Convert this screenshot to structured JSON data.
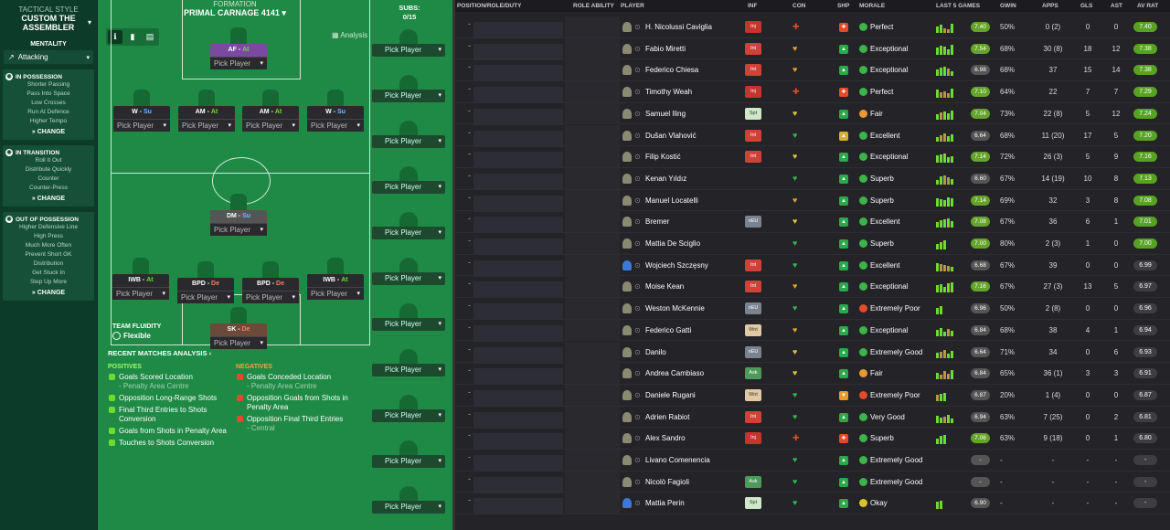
{
  "tactic": {
    "style_label": "TACTICAL STYLE",
    "style_value": "CUSTOM THE ASSEMBLER",
    "mentality_label": "MENTALITY",
    "mentality_value": "Attacking",
    "sections": [
      {
        "title": "IN POSSESSION",
        "items": [
          "Shorter Passing",
          "Pass Into Space",
          "Low Crosses",
          "Run At Defence",
          "Higher Tempo"
        ],
        "change": "CHANGE"
      },
      {
        "title": "IN TRANSITION",
        "items": [
          "Roll It Out",
          "Distribute Quickly",
          "Counter",
          "Counter-Press"
        ],
        "change": "CHANGE"
      },
      {
        "title": "OUT OF POSSESSION",
        "items": [
          "Higher Defensive Line",
          "High Press",
          "Much More Often",
          "Prevent Short GK",
          "Distribution",
          "Get Stuck In",
          "Step Up More"
        ],
        "change": "CHANGE"
      }
    ]
  },
  "formation": {
    "label": "FORMATION",
    "name": "PRIMAL CARNAGE 4141",
    "analysis": "Analysis",
    "pick": "Pick Player",
    "players": [
      {
        "pos": "AF",
        "duty": "At",
        "cls": "at"
      },
      {
        "pos": "W",
        "duty": "Su",
        "cls": "su"
      },
      {
        "pos": "AM",
        "duty": "At",
        "cls": "at"
      },
      {
        "pos": "AM",
        "duty": "At",
        "cls": "at"
      },
      {
        "pos": "W",
        "duty": "Su",
        "cls": "su"
      },
      {
        "pos": "DM",
        "duty": "Su",
        "cls": "su"
      },
      {
        "pos": "IWB",
        "duty": "At",
        "cls": "at"
      },
      {
        "pos": "BPD",
        "duty": "De",
        "cls": "de"
      },
      {
        "pos": "BPD",
        "duty": "De",
        "cls": "de"
      },
      {
        "pos": "IWB",
        "duty": "At",
        "cls": "at"
      },
      {
        "pos": "SK",
        "duty": "De",
        "cls": "de"
      }
    ],
    "fluidity_label": "TEAM FLUIDITY",
    "fluidity_value": "Flexible"
  },
  "subs": {
    "label": "SUBS:",
    "count": "0/15",
    "pick": "Pick Player"
  },
  "analysis": {
    "title": "RECENT MATCHES ANALYSIS ›",
    "pos_title": "POSITIVES",
    "neg_title": "NEGATIVES",
    "positives": [
      {
        "t": "Goals Scored Location",
        "s": "- Penalty Area Centre"
      },
      {
        "t": "Opposition Long-Range Shots",
        "s": ""
      },
      {
        "t": "Final Third Entries to Shots Conversion",
        "s": ""
      },
      {
        "t": "Goals from Shots in Penalty Area",
        "s": ""
      },
      {
        "t": "Touches to Shots Conversion",
        "s": ""
      }
    ],
    "negatives": [
      {
        "t": "Goals Conceded Location",
        "s": "- Penalty Area Centre"
      },
      {
        "t": "Opposition Goals from Shots in Penalty Area",
        "s": ""
      },
      {
        "t": "Opposition Final Third Entries",
        "s": "- Central"
      }
    ]
  },
  "table": {
    "headers": {
      "pos": "POSITION/ROLE/DUTY",
      "role": "ROLE ABILITY",
      "player": "PLAYER",
      "inf": "INF",
      "con": "CON",
      "shp": "SHP",
      "morale": "MORALE",
      "last5": "LAST 5 GAMES",
      "gwin": "GWIN",
      "apps": "APPS",
      "gls": "GLS",
      "ast": "AST",
      "avrat": "AV RAT"
    },
    "rows": [
      {
        "name": "H. Nicolussi Caviglia",
        "inf": "Inj",
        "ic": "inj",
        "con": "✚",
        "cc": "#e34a2a",
        "shp": "✚",
        "sc": "#e34a2a",
        "morale": "Perfect",
        "mc": "#3db34a",
        "lr": "7.40",
        "lg": true,
        "gw": "50%",
        "ap": "0 (2)",
        "gl": "0",
        "as": "0",
        "ar": "7.40",
        "ag": true,
        "gk": false
      },
      {
        "name": "Fabio Miretti",
        "inf": "Int",
        "ic": "int",
        "con": "♥",
        "cc": "#e0a030",
        "shp": "▲",
        "sc": "#2aa84a",
        "morale": "Exceptional",
        "mc": "#3db34a",
        "lr": "7.54",
        "lg": true,
        "gw": "68%",
        "ap": "30 (8)",
        "gl": "18",
        "as": "12",
        "ar": "7.38",
        "ag": true,
        "gk": false
      },
      {
        "name": "Federico Chiesa",
        "inf": "Int",
        "ic": "int",
        "con": "♥",
        "cc": "#e0a030",
        "shp": "▲",
        "sc": "#2aa84a",
        "morale": "Exceptional",
        "mc": "#3db34a",
        "lr": "6.98",
        "lg": false,
        "gw": "68%",
        "ap": "37",
        "gl": "15",
        "as": "14",
        "ar": "7.38",
        "ag": true,
        "gk": false
      },
      {
        "name": "Timothy Weah",
        "inf": "Inj",
        "ic": "inj",
        "con": "✚",
        "cc": "#e34a2a",
        "shp": "✚",
        "sc": "#e34a2a",
        "morale": "Perfect",
        "mc": "#3db34a",
        "lr": "7.10",
        "lg": true,
        "gw": "64%",
        "ap": "22",
        "gl": "7",
        "as": "7",
        "ar": "7.29",
        "ag": true,
        "gk": false
      },
      {
        "name": "Samuel Iling",
        "inf": "Spt",
        "ic": "spt",
        "con": "♥",
        "cc": "#d8c430",
        "shp": "▲",
        "sc": "#2aa84a",
        "morale": "Fair",
        "mc": "#e89a30",
        "lr": "7.04",
        "lg": true,
        "gw": "73%",
        "ap": "22 (8)",
        "gl": "5",
        "as": "12",
        "ar": "7.24",
        "ag": true,
        "gk": false
      },
      {
        "name": "Dušan Vlahović",
        "inf": "Int",
        "ic": "int",
        "con": "♥",
        "cc": "#2ab84a",
        "shp": "▲",
        "sc": "#d8b030",
        "morale": "Excellent",
        "mc": "#3db34a",
        "lr": "6.64",
        "lg": false,
        "gw": "68%",
        "ap": "11 (20)",
        "gl": "17",
        "as": "5",
        "ar": "7.20",
        "ag": true,
        "gk": false
      },
      {
        "name": "Filip Kostić",
        "inf": "Int",
        "ic": "int",
        "con": "♥",
        "cc": "#d8c430",
        "shp": "▲",
        "sc": "#2aa84a",
        "morale": "Exceptional",
        "mc": "#3db34a",
        "lr": "7.14",
        "lg": true,
        "gw": "72%",
        "ap": "26 (3)",
        "gl": "5",
        "as": "9",
        "ar": "7.16",
        "ag": true,
        "gk": false
      },
      {
        "name": "Kenan Yıldız",
        "inf": "",
        "ic": "none",
        "con": "♥",
        "cc": "#2ab84a",
        "shp": "▲",
        "sc": "#2aa84a",
        "morale": "Superb",
        "mc": "#3db34a",
        "lr": "6.60",
        "lg": false,
        "gw": "67%",
        "ap": "14 (19)",
        "gl": "10",
        "as": "8",
        "ar": "7.13",
        "ag": true,
        "gk": false
      },
      {
        "name": "Manuel Locatelli",
        "inf": "",
        "ic": "none",
        "con": "♥",
        "cc": "#e0a030",
        "shp": "▲",
        "sc": "#2aa84a",
        "morale": "Superb",
        "mc": "#3db34a",
        "lr": "7.14",
        "lg": true,
        "gw": "69%",
        "ap": "32",
        "gl": "3",
        "as": "8",
        "ar": "7.08",
        "ag": true,
        "gk": false
      },
      {
        "name": "Bremer",
        "inf": "nEU",
        "ic": "neu",
        "con": "♥",
        "cc": "#d8c430",
        "shp": "▲",
        "sc": "#2aa84a",
        "morale": "Excellent",
        "mc": "#3db34a",
        "lr": "7.08",
        "lg": true,
        "gw": "67%",
        "ap": "36",
        "gl": "6",
        "as": "1",
        "ar": "7.01",
        "ag": true,
        "gk": false
      },
      {
        "name": "Mattia De Sciglio",
        "inf": "",
        "ic": "none",
        "con": "♥",
        "cc": "#2ab84a",
        "shp": "▲",
        "sc": "#2aa84a",
        "morale": "Superb",
        "mc": "#3db34a",
        "lr": "7.00",
        "lg": true,
        "gw": "80%",
        "ap": "2 (3)",
        "gl": "1",
        "as": "0",
        "ar": "7.00",
        "ag": true,
        "gk": false
      },
      {
        "name": "Wojciech Szczęsny",
        "inf": "Int",
        "ic": "int",
        "con": "♥",
        "cc": "#2ab84a",
        "shp": "▲",
        "sc": "#2aa84a",
        "morale": "Excellent",
        "mc": "#3db34a",
        "lr": "6.68",
        "lg": false,
        "gw": "67%",
        "ap": "39",
        "gl": "0",
        "as": "0",
        "ar": "6.99",
        "ag": false,
        "gk": true
      },
      {
        "name": "Moise Kean",
        "inf": "Int",
        "ic": "int",
        "con": "♥",
        "cc": "#e0a030",
        "shp": "▲",
        "sc": "#2aa84a",
        "morale": "Exceptional",
        "mc": "#3db34a",
        "lr": "7.16",
        "lg": true,
        "gw": "67%",
        "ap": "27 (3)",
        "gl": "13",
        "as": "5",
        "ar": "6.97",
        "ag": false,
        "gk": false
      },
      {
        "name": "Weston McKennie",
        "inf": "nEU",
        "ic": "neu",
        "con": "♥",
        "cc": "#2ab84a",
        "shp": "▲",
        "sc": "#2aa84a",
        "morale": "Extremely Poor",
        "mc": "#e34a2a",
        "lr": "6.96",
        "lg": false,
        "gw": "50%",
        "ap": "2 (8)",
        "gl": "0",
        "as": "0",
        "ar": "6.96",
        "ag": false,
        "gk": false
      },
      {
        "name": "Federico Gatti",
        "inf": "Wnt",
        "ic": "wnt",
        "con": "♥",
        "cc": "#e0a030",
        "shp": "▲",
        "sc": "#2aa84a",
        "morale": "Exceptional",
        "mc": "#3db34a",
        "lr": "6.84",
        "lg": false,
        "gw": "68%",
        "ap": "38",
        "gl": "4",
        "as": "1",
        "ar": "6.94",
        "ag": false,
        "gk": false
      },
      {
        "name": "Danilo",
        "inf": "nEU",
        "ic": "neu",
        "con": "♥",
        "cc": "#d8c430",
        "shp": "▲",
        "sc": "#2aa84a",
        "morale": "Extremely Good",
        "mc": "#3db34a",
        "lr": "6.64",
        "lg": false,
        "gw": "71%",
        "ap": "34",
        "gl": "0",
        "as": "6",
        "ar": "6.93",
        "ag": false,
        "gk": false
      },
      {
        "name": "Andrea Cambiaso",
        "inf": "Ask",
        "ic": "ask",
        "con": "♥",
        "cc": "#d8c430",
        "shp": "▲",
        "sc": "#2aa84a",
        "morale": "Fair",
        "mc": "#e89a30",
        "lr": "6.84",
        "lg": false,
        "gw": "65%",
        "ap": "36 (1)",
        "gl": "3",
        "as": "3",
        "ar": "6.91",
        "ag": false,
        "gk": false
      },
      {
        "name": "Daniele Rugani",
        "inf": "Wnt",
        "ic": "wnt",
        "con": "♥",
        "cc": "#2ab84a",
        "shp": "▼",
        "sc": "#e89a30",
        "morale": "Extremely Poor",
        "mc": "#e34a2a",
        "lr": "6.87",
        "lg": false,
        "gw": "20%",
        "ap": "1 (4)",
        "gl": "0",
        "as": "0",
        "ar": "6.87",
        "ag": false,
        "gk": false
      },
      {
        "name": "Adrien Rabiot",
        "inf": "Int",
        "ic": "int",
        "con": "♥",
        "cc": "#2ab84a",
        "shp": "▲",
        "sc": "#2aa84a",
        "morale": "Very Good",
        "mc": "#3db34a",
        "lr": "6.94",
        "lg": false,
        "gw": "63%",
        "ap": "7 (25)",
        "gl": "0",
        "as": "2",
        "ar": "6.81",
        "ag": false,
        "gk": false
      },
      {
        "name": "Alex Sandro",
        "inf": "Inj",
        "ic": "inj",
        "con": "✚",
        "cc": "#e34a2a",
        "shp": "✚",
        "sc": "#e34a2a",
        "morale": "Superb",
        "mc": "#3db34a",
        "lr": "7.06",
        "lg": true,
        "gw": "63%",
        "ap": "9 (18)",
        "gl": "0",
        "as": "1",
        "ar": "6.80",
        "ag": false,
        "gk": false
      },
      {
        "name": "Livano Comenencia",
        "inf": "",
        "ic": "none",
        "con": "♥",
        "cc": "#2ab84a",
        "shp": "▲",
        "sc": "#2aa84a",
        "morale": "Extremely Good",
        "mc": "#3db34a",
        "lr": "-",
        "lg": false,
        "gw": "-",
        "ap": "-",
        "gl": "-",
        "as": "-",
        "ar": "-",
        "ag": false,
        "gk": false
      },
      {
        "name": "Nicolò Fagioli",
        "inf": "Ask",
        "ic": "ask",
        "con": "♥",
        "cc": "#2ab84a",
        "shp": "▲",
        "sc": "#2aa84a",
        "morale": "Extremely Good",
        "mc": "#3db34a",
        "lr": "-",
        "lg": false,
        "gw": "-",
        "ap": "-",
        "gl": "-",
        "as": "-",
        "ar": "-",
        "ag": false,
        "gk": false
      },
      {
        "name": "Mattia Perin",
        "inf": "Spt",
        "ic": "spt",
        "con": "♥",
        "cc": "#2ab84a",
        "shp": "▲",
        "sc": "#2aa84a",
        "morale": "Okay",
        "mc": "#d8c430",
        "lr": "6.90",
        "lg": false,
        "gw": "-",
        "ap": "-",
        "gl": "-",
        "as": "-",
        "ar": "-",
        "ag": false,
        "gk": true
      }
    ]
  }
}
